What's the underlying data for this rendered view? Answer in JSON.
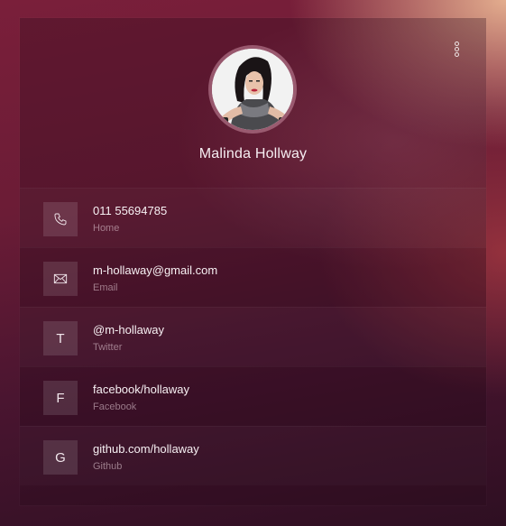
{
  "profile": {
    "name": "Malinda Hollway"
  },
  "contacts": [
    {
      "icon": "phone-icon",
      "value": "011 55694785",
      "label": "Home"
    },
    {
      "icon": "envelope-icon",
      "value": "m-hollaway@gmail.com",
      "label": "Email"
    },
    {
      "icon": "twitter-letter-icon",
      "glyph": "T",
      "value": "@m-hollaway",
      "label": "Twitter"
    },
    {
      "icon": "facebook-letter-icon",
      "glyph": "F",
      "value": "facebook/hollaway",
      "label": "Facebook"
    },
    {
      "icon": "github-letter-icon",
      "glyph": "G",
      "value": "github.com/hollaway",
      "label": "Github"
    }
  ]
}
